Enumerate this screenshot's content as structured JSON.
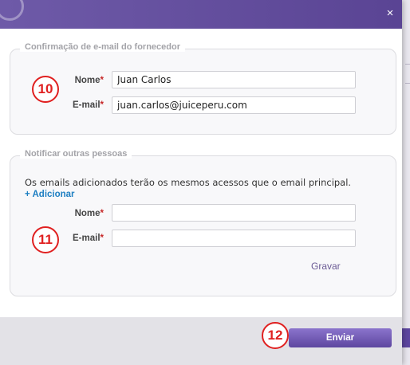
{
  "header": {
    "close_icon": "close-icon",
    "close_glyph": "×"
  },
  "supplier_confirmation": {
    "legend": "Confirmação de e-mail do fornecedor",
    "badge": "10",
    "name_label": "Nome",
    "name_value": "Juan Carlos",
    "email_label": "E-mail",
    "email_value": "juan.carlos@juiceperu.com",
    "required_mark": "*"
  },
  "notify_others": {
    "legend": "Notificar outras pessoas",
    "info_text": "Os emails adicionados terão os mesmos acessos que o email principal.",
    "add_link": "+ Adicionar",
    "badge": "11",
    "name_label": "Nome",
    "name_value": "",
    "email_label": "E-mail",
    "email_value": "",
    "required_mark": "*",
    "save_link": "Gravar"
  },
  "footer": {
    "badge": "12",
    "submit_label": "Enviar"
  },
  "colors": {
    "header": "#5a4494",
    "button": "#6a54ad",
    "annotation": "#e02020",
    "link": "#1e7fc2"
  }
}
